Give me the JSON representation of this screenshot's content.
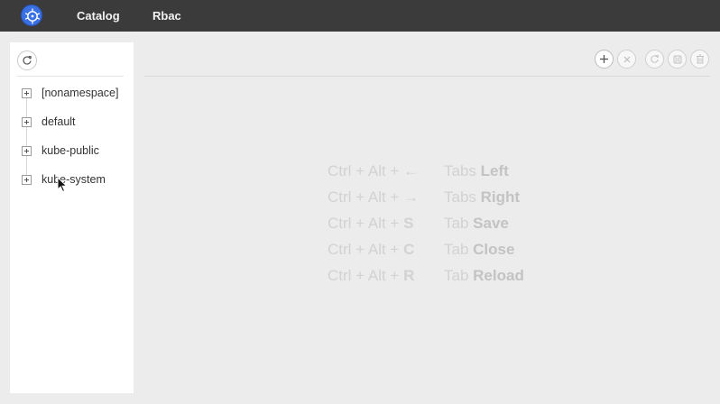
{
  "topbar": {
    "logo_icon": "kubernetes-helm-icon",
    "nav": [
      {
        "label": "Catalog"
      },
      {
        "label": "Rbac"
      }
    ]
  },
  "sidebar": {
    "refresh_icon": "refresh-icon",
    "tree": [
      {
        "label": "[nonamespace]"
      },
      {
        "label": "default"
      },
      {
        "label": "kube-public"
      },
      {
        "label": "kube-system"
      }
    ]
  },
  "toolbar": {
    "buttons": [
      {
        "icon": "plus-icon",
        "enabled": true
      },
      {
        "icon": "close-icon",
        "enabled": false
      },
      {
        "icon": "reload-icon",
        "enabled": false
      },
      {
        "icon": "save-icon",
        "enabled": false
      },
      {
        "icon": "trash-icon",
        "enabled": false
      }
    ]
  },
  "shortcuts": [
    {
      "keys": "Ctrl + Alt +",
      "key": "←",
      "prefix": "Tabs",
      "action": "Left"
    },
    {
      "keys": "Ctrl + Alt +",
      "key": "→",
      "prefix": "Tabs",
      "action": "Right"
    },
    {
      "keys": "Ctrl + Alt +",
      "key": "S",
      "prefix": "Tab",
      "action": "Save"
    },
    {
      "keys": "Ctrl + Alt +",
      "key": "C",
      "prefix": "Tab",
      "action": "Close"
    },
    {
      "keys": "Ctrl + Alt +",
      "key": "R",
      "prefix": "Tab",
      "action": "Reload"
    }
  ],
  "colors": {
    "topbar": "#3b3b3b",
    "logo": "#3970e4",
    "background": "#ececec",
    "sidebar": "#ffffff"
  }
}
